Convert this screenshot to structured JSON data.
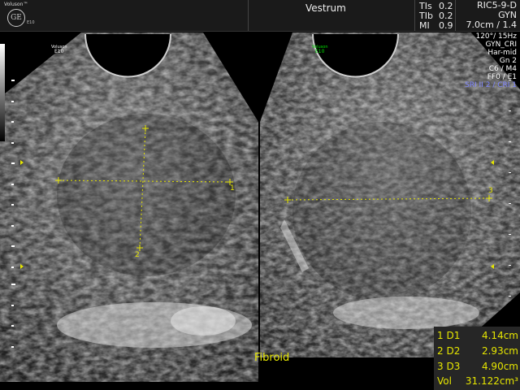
{
  "header": {
    "brand": "Voluson™",
    "logo_mark": "GE",
    "model": "E10",
    "patient": "Vestrum",
    "thermal": [
      {
        "label": "TIs",
        "value": "0.2"
      },
      {
        "label": "TIb",
        "value": "0.2"
      },
      {
        "label": "MI",
        "value": "0.9"
      }
    ],
    "probe": "RIC5-9-D",
    "application": "GYN",
    "depth": "7.0cm / 1.4"
  },
  "params": {
    "angle_rate": "120°/ 15Hz",
    "preset": "GYN_CRI",
    "harmonic": "Har-mid",
    "gain": "Gn 2",
    "c_m": "C6 / M4",
    "ff": "FF0 / E1",
    "sri": "SRI II 2 / CRI 1"
  },
  "panels": {
    "left": {
      "label_top": "Voluson",
      "label_bottom": "E10",
      "label_color": "#ffffff"
    },
    "right": {
      "label_top": "Voluson",
      "label_bottom": "E10",
      "label_color": "#00e000"
    }
  },
  "calipers": {
    "one": "1",
    "two": "2",
    "three": "3"
  },
  "caption": "Fibroid",
  "measurements": [
    {
      "label": "1 D1",
      "value": "4.14cm"
    },
    {
      "label": "2 D2",
      "value": "2.93cm"
    },
    {
      "label": "3 D3",
      "value": "4.90cm"
    },
    {
      "label": "Vol",
      "value": "31.122cm³"
    }
  ],
  "colors": {
    "caliper": "#e6e600",
    "accent_sri": "#7f86ff"
  }
}
